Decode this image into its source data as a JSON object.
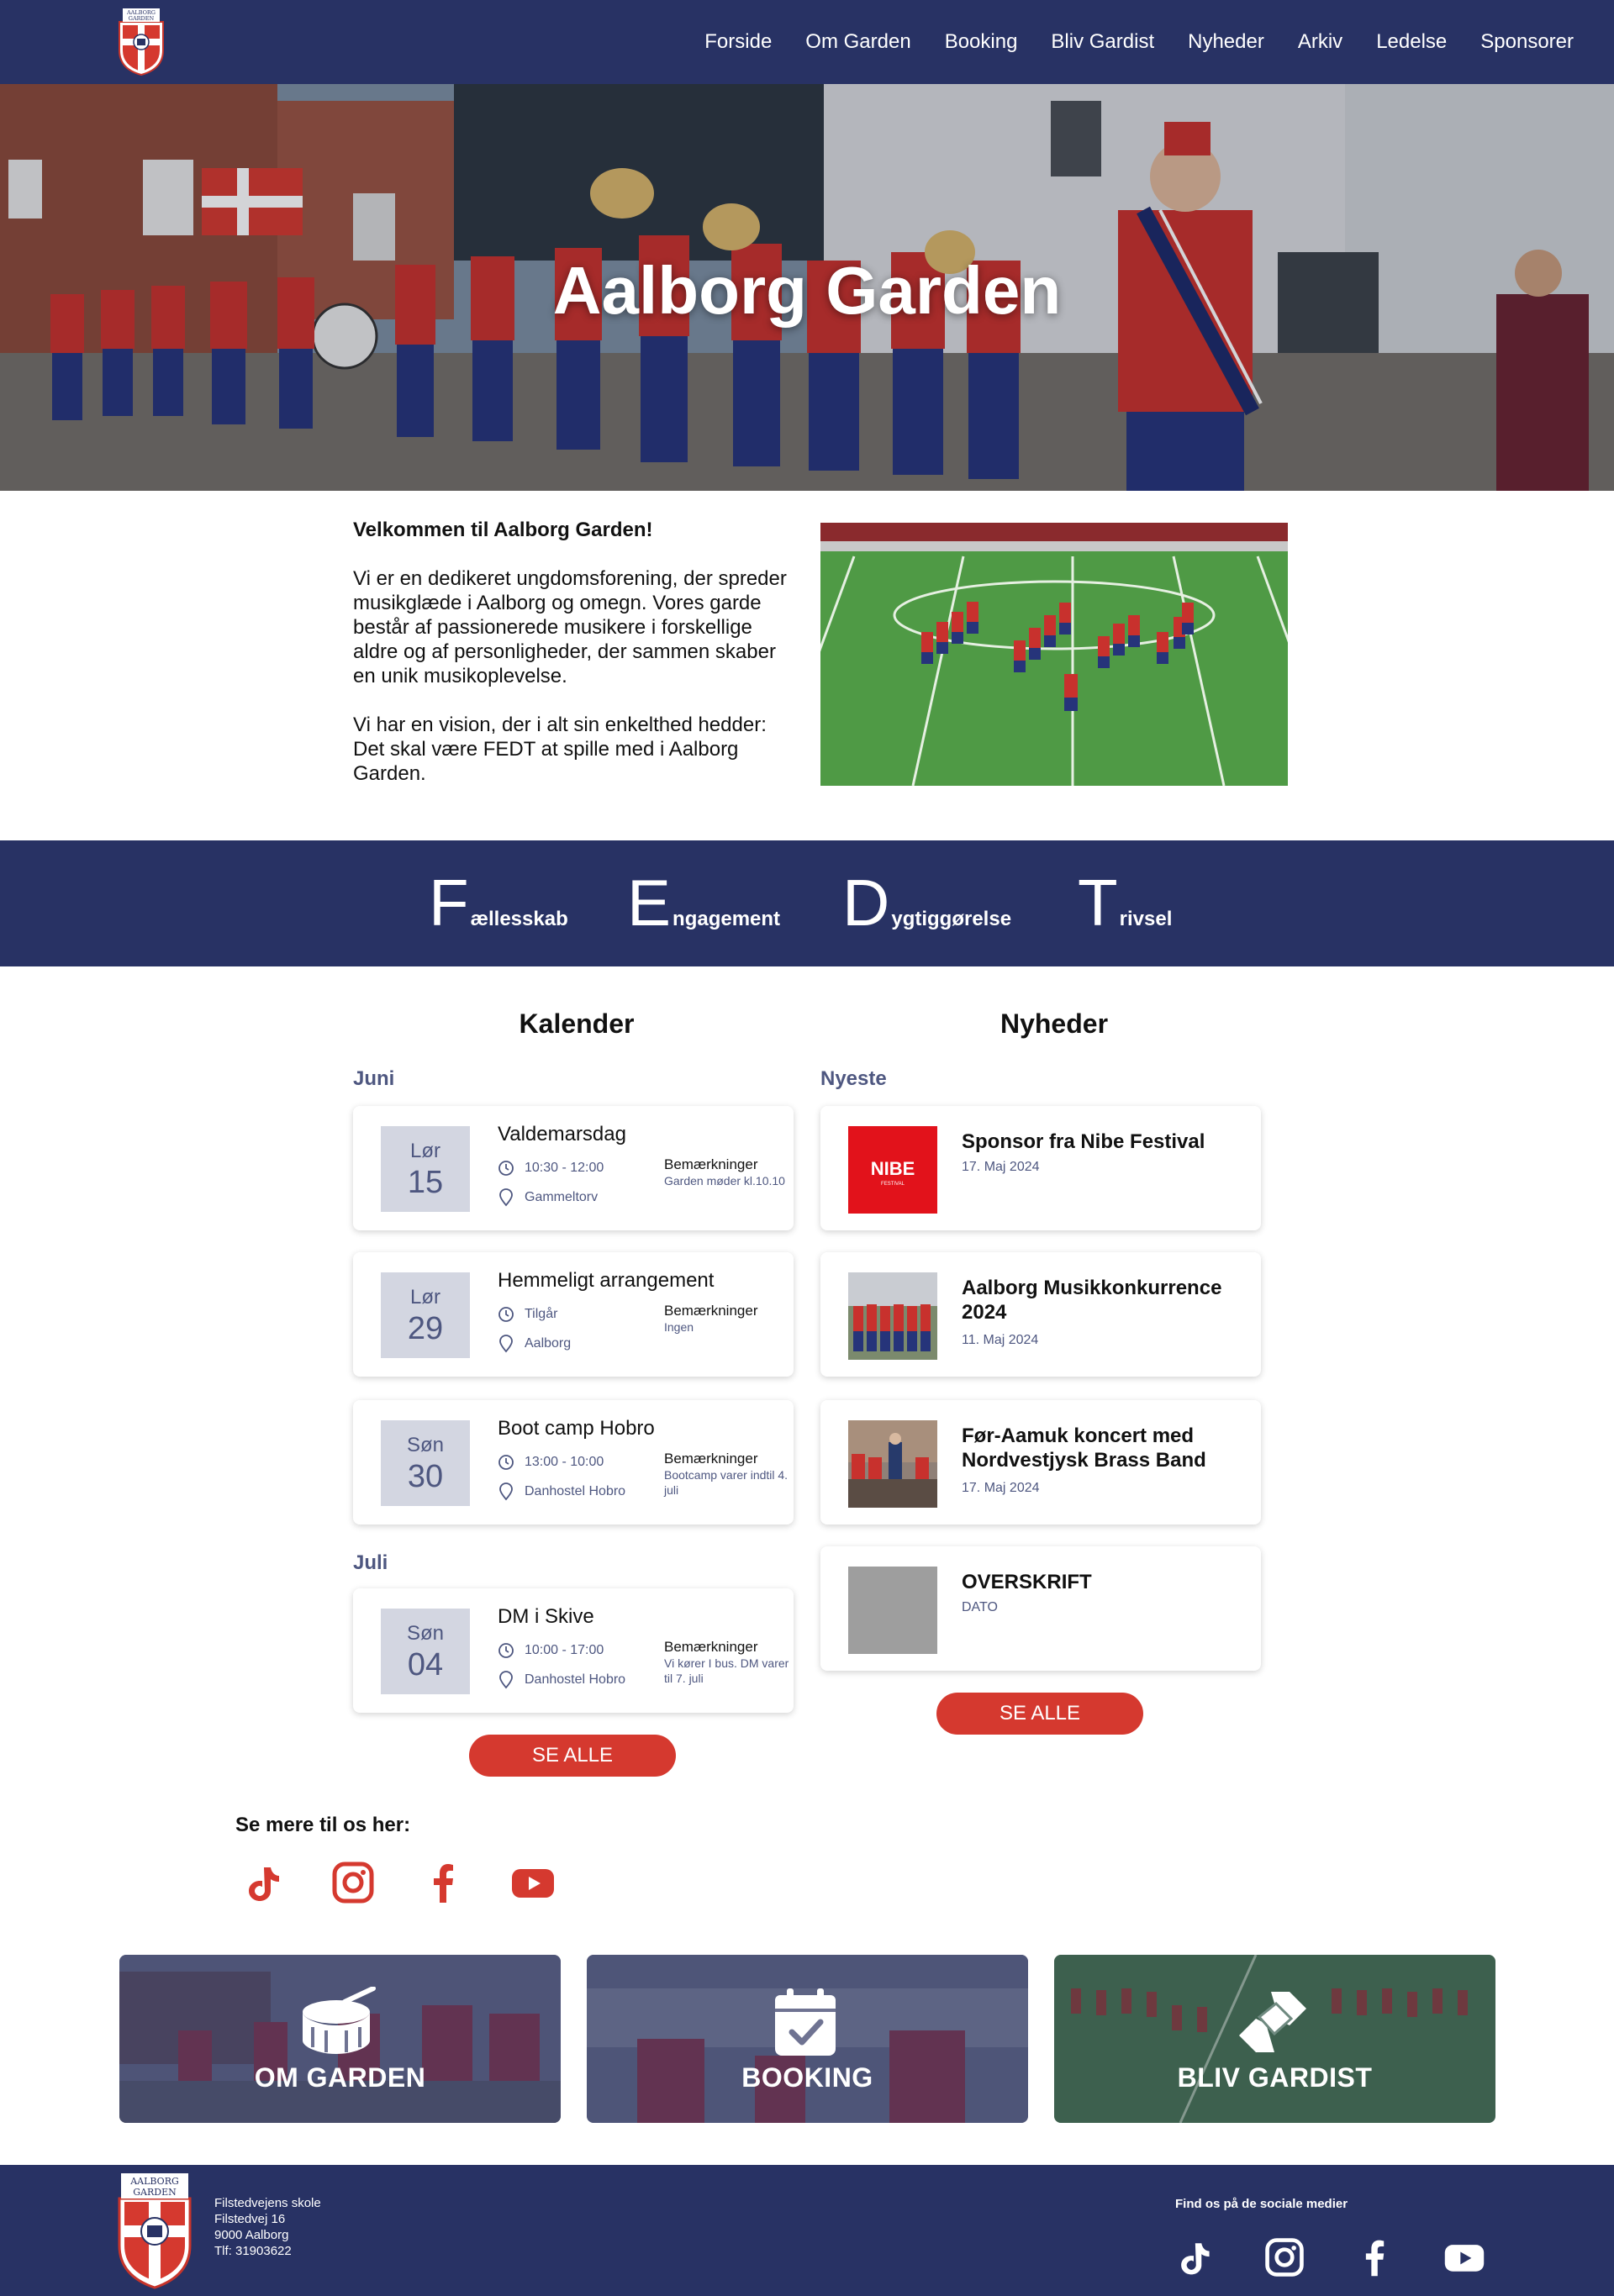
{
  "nav": {
    "logo_text": "AALBORG GARDEN",
    "items": [
      "Forside",
      "Om Garden",
      "Booking",
      "Bliv Gardist",
      "Nyheder",
      "Arkiv",
      "Ledelse",
      "Sponsorer"
    ]
  },
  "hero": {
    "title": "Aalborg Garden"
  },
  "welcome": {
    "title": "Velkommen til Aalborg Garden!",
    "p1": "Vi er en dedikeret ungdomsforening, der spreder musikglæde i Aalborg og omegn. Vores garde består af passionerede musikere i forskellige aldre og af personligheder, der sammen skaber en unik musikoplevelse.",
    "p2": "Vi har en vision, der i alt sin enkelthed hedder: Det skal være FEDT at spille med i Aalborg Garden."
  },
  "fedt": [
    {
      "letter": "F",
      "rest": "ællesskab"
    },
    {
      "letter": "E",
      "rest": "ngagement"
    },
    {
      "letter": "D",
      "rest": "ygtiggørelse"
    },
    {
      "letter": "T",
      "rest": "rivsel"
    }
  ],
  "calendar": {
    "title": "Kalender",
    "remarks_label": "Bemærkninger",
    "months": [
      "Juni",
      "Juli"
    ],
    "events": [
      {
        "day": "Lør",
        "num": "15",
        "title": "Valdemarsdag",
        "time": "10:30 - 12:00",
        "place": "Gammeltorv",
        "remark": "Garden møder kl.10.10"
      },
      {
        "day": "Lør",
        "num": "29",
        "title": "Hemmeligt arrangement",
        "time": "Tilgår",
        "place": "Aalborg",
        "remark": "Ingen"
      },
      {
        "day": "Søn",
        "num": "30",
        "title": "Boot camp Hobro",
        "time": "13:00 - 10:00",
        "place": "Danhostel Hobro",
        "remark": "Bootcamp varer indtil 4. juli"
      },
      {
        "day": "Søn",
        "num": "04",
        "title": "DM i Skive",
        "time": "10:00 - 17:00",
        "place": "Danhostel Hobro",
        "remark": "Vi kører I bus. DM varer til 7. juli"
      }
    ],
    "button": "SE ALLE"
  },
  "news": {
    "title": "Nyheder",
    "label": "Nyeste",
    "items": [
      {
        "title": "Sponsor fra Nibe Festival",
        "date": "17. Maj 2024",
        "thumb": "nibe-festival-logo"
      },
      {
        "title": "Aalborg Musikkonkurrence 2024",
        "date": "11. Maj 2024",
        "thumb": "band-photo"
      },
      {
        "title": "Før-Aamuk koncert med Nordvestjysk Brass Band",
        "date": "17. Maj 2024",
        "thumb": "concert-photo"
      },
      {
        "title": "OVERSKRIFT",
        "date": "DATO",
        "thumb": "placeholder"
      }
    ],
    "thumb_logo_text": "NIBE",
    "thumb_logo_sub": "FESTIVAL",
    "button": "SE ALLE"
  },
  "social": {
    "title": "Se mere til os her:",
    "icons": [
      "tiktok-icon",
      "instagram-icon",
      "facebook-icon",
      "youtube-icon"
    ],
    "color": "#d5392f"
  },
  "tiles": [
    {
      "label": "OM GARDEN",
      "icon": "drum-icon"
    },
    {
      "label": "BOOKING",
      "icon": "calendar-check-icon"
    },
    {
      "label": "BLIV GARDIST",
      "icon": "handshake-icon"
    }
  ],
  "footer": {
    "address": [
      "Filstedvejens skole",
      "Filstedvej 16",
      "9000 Aalborg",
      "Tlf: 31903622"
    ],
    "find_label": "Find os på de sociale medier"
  },
  "colors": {
    "navy": "#283264",
    "red": "#d5392f",
    "muted": "#4e5780",
    "datebox": "#d3d6e1"
  }
}
